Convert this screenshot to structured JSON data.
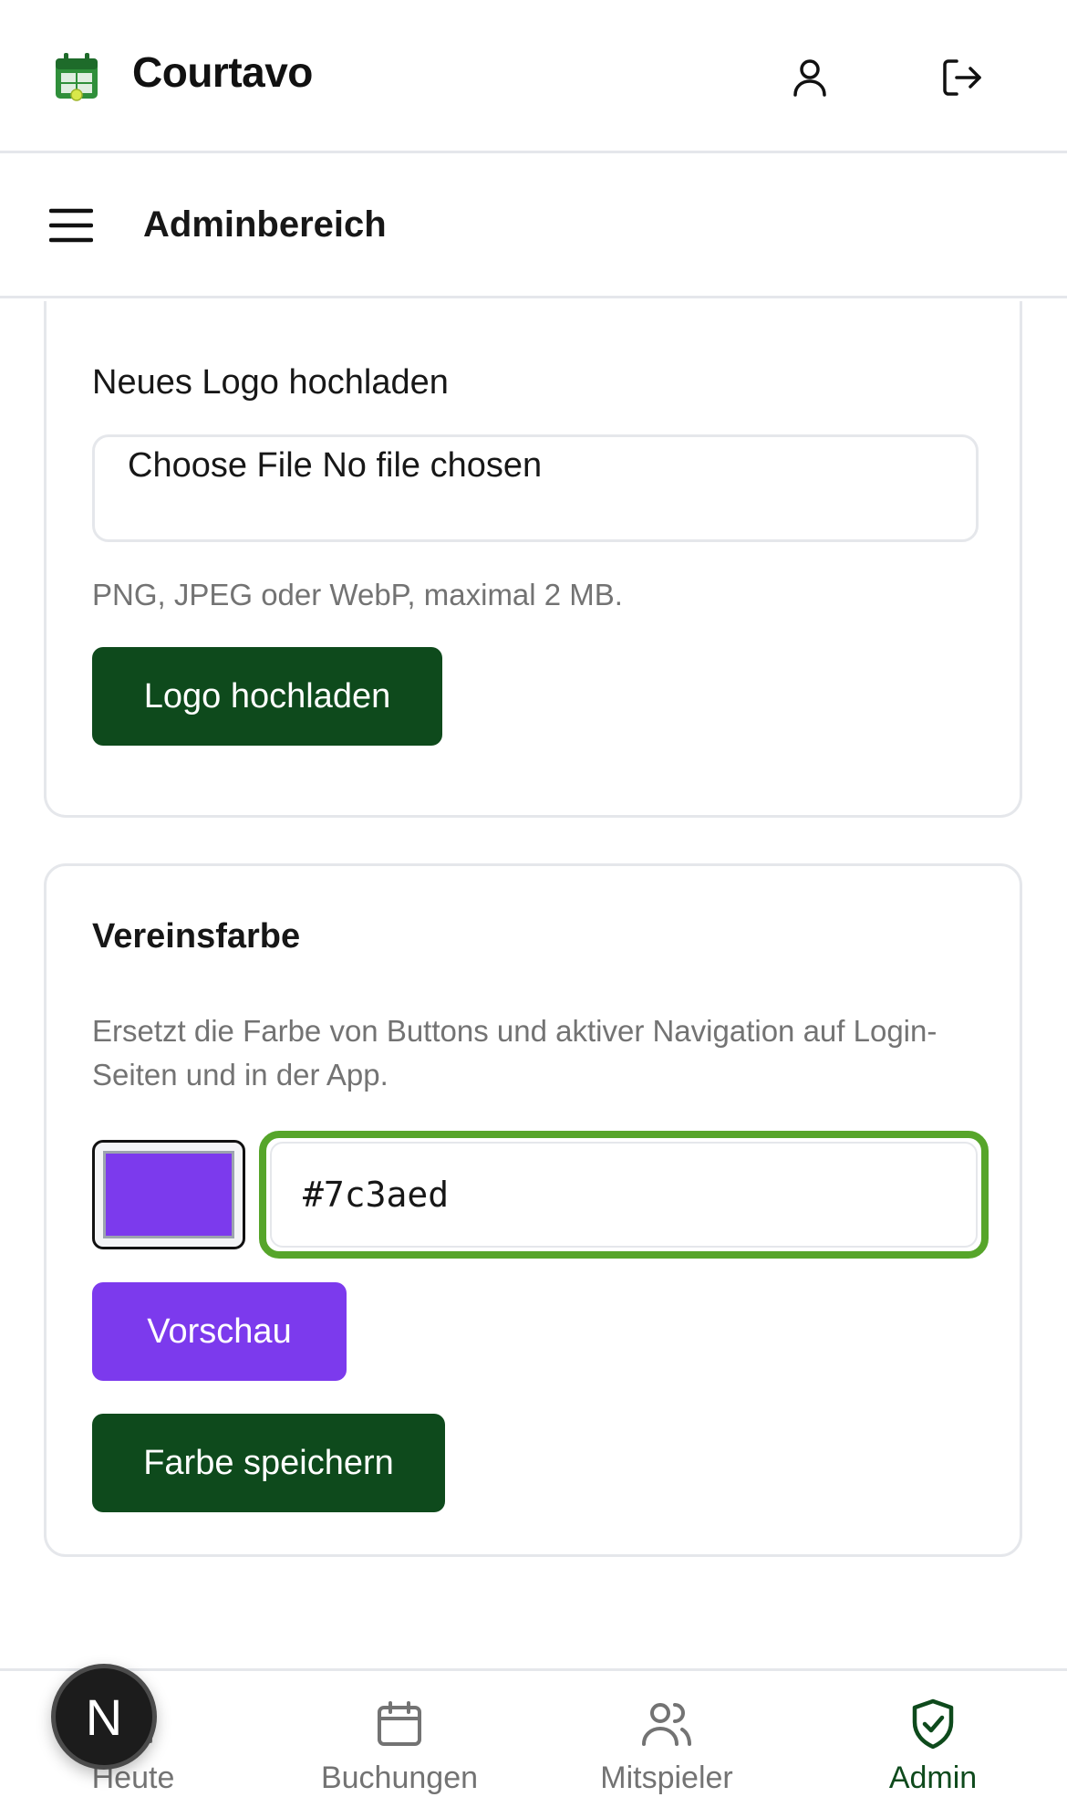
{
  "app": {
    "name": "Courtavo",
    "icons": {
      "logo": "tennis-court-calendar-icon",
      "profile": "user-icon",
      "logout": "logout-icon"
    }
  },
  "subheader": {
    "title": "Adminbereich",
    "menu_icon": "hamburger-menu-icon"
  },
  "logo_card": {
    "upload_label": "Neues Logo hochladen",
    "file_input_text": "Choose File No file chosen",
    "hint": "PNG, JPEG oder WebP, maximal 2 MB.",
    "upload_button": "Logo hochladen"
  },
  "color_card": {
    "title": "Vereinsfarbe",
    "description": "Ersetzt die Farbe von Buttons und aktiver Navigation auf Login-Seiten und in der App.",
    "swatch_color": "#7c3aed",
    "hex_value": "#7c3aed",
    "preview_button": "Vorschau",
    "save_button": "Farbe speichern"
  },
  "bottom_nav": {
    "items": [
      {
        "label": "Heute",
        "icon": "home-icon",
        "active": false
      },
      {
        "label": "Buchungen",
        "icon": "calendar-icon",
        "active": false
      },
      {
        "label": "Mitspieler",
        "icon": "users-icon",
        "active": false
      },
      {
        "label": "Admin",
        "icon": "shield-check-icon",
        "active": true
      }
    ]
  },
  "dev_badge": {
    "letter": "N"
  },
  "colors": {
    "primary": "#0e4a1c",
    "accent_preview": "#7c3aed",
    "focus_ring": "#56a52a",
    "muted_text": "#737373",
    "border": "#e5e7eb"
  }
}
